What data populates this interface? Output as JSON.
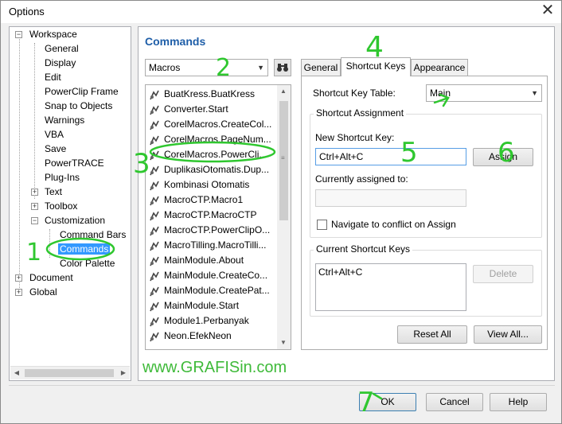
{
  "window": {
    "title": "Options"
  },
  "tree": {
    "items": [
      {
        "label": "Workspace"
      },
      {
        "label": "General"
      },
      {
        "label": "Display"
      },
      {
        "label": "Edit"
      },
      {
        "label": "PowerClip Frame"
      },
      {
        "label": "Snap to Objects"
      },
      {
        "label": "Warnings"
      },
      {
        "label": "VBA"
      },
      {
        "label": "Save"
      },
      {
        "label": "PowerTRACE"
      },
      {
        "label": "Plug-Ins"
      },
      {
        "label": "Text"
      },
      {
        "label": "Toolbox"
      },
      {
        "label": "Customization"
      },
      {
        "label": "Command Bars"
      },
      {
        "label": "Commands"
      },
      {
        "label": "Color Palette"
      },
      {
        "label": "Document"
      },
      {
        "label": "Global"
      }
    ]
  },
  "commands": {
    "title": "Commands",
    "category_dropdown": "Macros",
    "list": [
      "BuatKress.BuatKress",
      "Converter.Start",
      "CorelMacros.CreateCol...",
      "CorelMacros.PageNum...",
      "CorelMacros.PowerCli...",
      "DuplikasiOtomatis.Dup...",
      "Kombinasi Otomatis",
      "MacroCTP.Macro1",
      "MacroCTP.MacroCTP",
      "MacroCTP.PowerClipO...",
      "MacroTilling.MacroTilli...",
      "MainModule.About",
      "MainModule.CreateCo...",
      "MainModule.CreatePat...",
      "MainModule.Start",
      "Module1.Perbanyak",
      "Neon.EfekNeon"
    ]
  },
  "tabs": [
    {
      "label": "General"
    },
    {
      "label": "Shortcut Keys"
    },
    {
      "label": "Appearance"
    }
  ],
  "shortcut": {
    "table_label": "Shortcut Key Table:",
    "table_value": "Main",
    "assignment_group": "Shortcut Assignment",
    "new_key_label": "New Shortcut Key:",
    "new_key_value": "Ctrl+Alt+C",
    "assign_button": "Assign",
    "currently_assigned_label": "Currently assigned to:",
    "currently_assigned_value": "",
    "navigate_checkbox": "Navigate to conflict on Assign",
    "navigate_checked": false,
    "current_keys_group": "Current Shortcut Keys",
    "current_keys": [
      "Ctrl+Alt+C"
    ],
    "delete_button": "Delete",
    "reset_all_button": "Reset All",
    "view_all_button": "View All..."
  },
  "watermark": "www.GRAFISin.com",
  "footer": {
    "ok": "OK",
    "cancel": "Cancel",
    "help": "Help"
  },
  "annotations": [
    "1",
    "2",
    "3",
    "4",
    "5",
    "6",
    "7"
  ],
  "colors": {
    "annotation": "#2fc72f",
    "title_blue": "#1e5ea8",
    "selection": "#3399ff"
  }
}
